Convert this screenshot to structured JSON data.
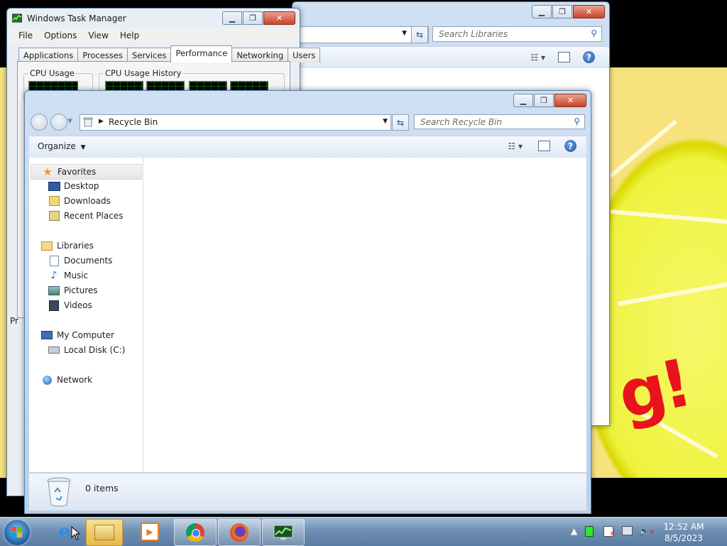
{
  "desktop": {
    "wallpaper_text": "g!"
  },
  "libraries_window": {
    "search_placeholder": "Search Libraries",
    "help": "?"
  },
  "task_manager": {
    "title": "Windows Task Manager",
    "menu": [
      "File",
      "Options",
      "View",
      "Help"
    ],
    "tabs": [
      "Applications",
      "Processes",
      "Services",
      "Performance",
      "Networking",
      "Users"
    ],
    "active_tab": "Performance",
    "cpu_usage_label": "CPU Usage",
    "cpu_history_label": "CPU Usage History",
    "status_text": "Pr"
  },
  "recycle_bin": {
    "address_path": "Recycle Bin",
    "search_placeholder": "Search Recycle Bin",
    "organize_label": "Organize",
    "help": "?",
    "nav": {
      "favorites": "Favorites",
      "desktop": "Desktop",
      "downloads": "Downloads",
      "recent_places": "Recent Places",
      "libraries": "Libraries",
      "documents": "Documents",
      "music": "Music",
      "pictures": "Pictures",
      "videos": "Videos",
      "my_computer": "My Computer",
      "local_disk": "Local Disk (C:)",
      "network": "Network"
    },
    "status_count": "0 items"
  },
  "taskbar": {
    "time": "12:52 AM",
    "date": "8/5/2023",
    "apps": [
      "internet-explorer",
      "windows-explorer",
      "media-player",
      "chrome",
      "firefox",
      "task-manager"
    ]
  },
  "colors": {
    "accent": "#1f56a8",
    "close_button": "#c9452c",
    "taskbar_active": "#e7b84a"
  }
}
